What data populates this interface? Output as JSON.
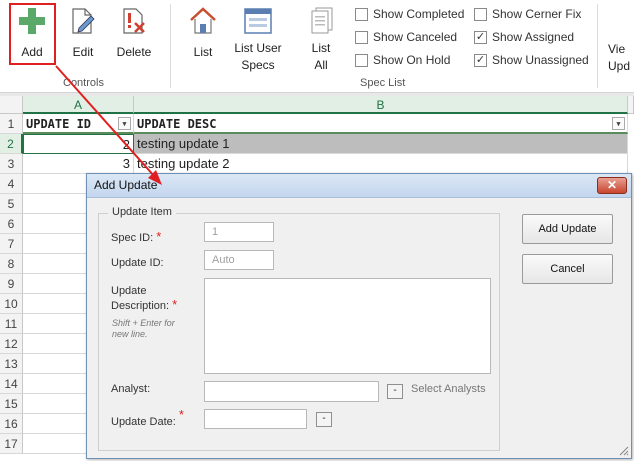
{
  "ribbon": {
    "controls": [
      {
        "label": "Add",
        "icon": "plus-icon"
      },
      {
        "label": "Edit",
        "icon": "edit-icon"
      },
      {
        "label": "Delete",
        "icon": "delete-icon"
      }
    ],
    "controls_group_label": "Controls",
    "spec_list": [
      {
        "label": "List",
        "icon": "house-icon"
      },
      {
        "label": "List User Specs",
        "label_line1": "List User",
        "label_line2": "Specs",
        "icon": "form-icon"
      },
      {
        "label": "List All",
        "label_line1": "List",
        "label_line2": "All",
        "icon": "documents-icon"
      }
    ],
    "spec_list_group_label": "Spec List",
    "checkboxes": [
      {
        "label": "Show Completed",
        "checked": false
      },
      {
        "label": "Show Canceled",
        "checked": false
      },
      {
        "label": "Show On Hold",
        "checked": false
      },
      {
        "label": "Show Cerner Fix",
        "checked": false
      },
      {
        "label": "Show Assigned",
        "checked": true
      },
      {
        "label": "Show Unassigned",
        "checked": true
      }
    ],
    "view_partial_line1": "Vie",
    "view_partial_line2": "Upd"
  },
  "sheet": {
    "columns": [
      "A",
      "B"
    ],
    "row_numbers": [
      "1",
      "2",
      "3",
      "4",
      "5",
      "6",
      "7",
      "8",
      "9",
      "10",
      "11",
      "12",
      "13",
      "14",
      "15",
      "16",
      "17"
    ],
    "headers": [
      "UPDATE ID",
      "UPDATE DESC"
    ],
    "rows": [
      {
        "id": "2",
        "desc": "testing update 1"
      },
      {
        "id": "3",
        "desc": "testing update 2"
      }
    ]
  },
  "dialog": {
    "title": "Add Update",
    "close_label": "✕",
    "group_label": "Update Item",
    "spec_id_label": "Spec ID:",
    "spec_id_value": "1",
    "update_id_label": "Update ID:",
    "update_id_value": "Auto",
    "desc_label_line1": "Update",
    "desc_label_line2": "Description:",
    "desc_hint": "Shift + Enter for new line.",
    "analyst_label": "Analyst:",
    "analyst_button": "-",
    "select_analysts_label": "Select Analysts",
    "update_date_label": "Update Date:",
    "date_button": "-",
    "required_mark": "*",
    "add_update_button": "Add Update",
    "cancel_button": "Cancel"
  },
  "colors": {
    "accent_red": "#e02020",
    "excel_green": "#217346",
    "plus_green": "#5aa86a"
  }
}
